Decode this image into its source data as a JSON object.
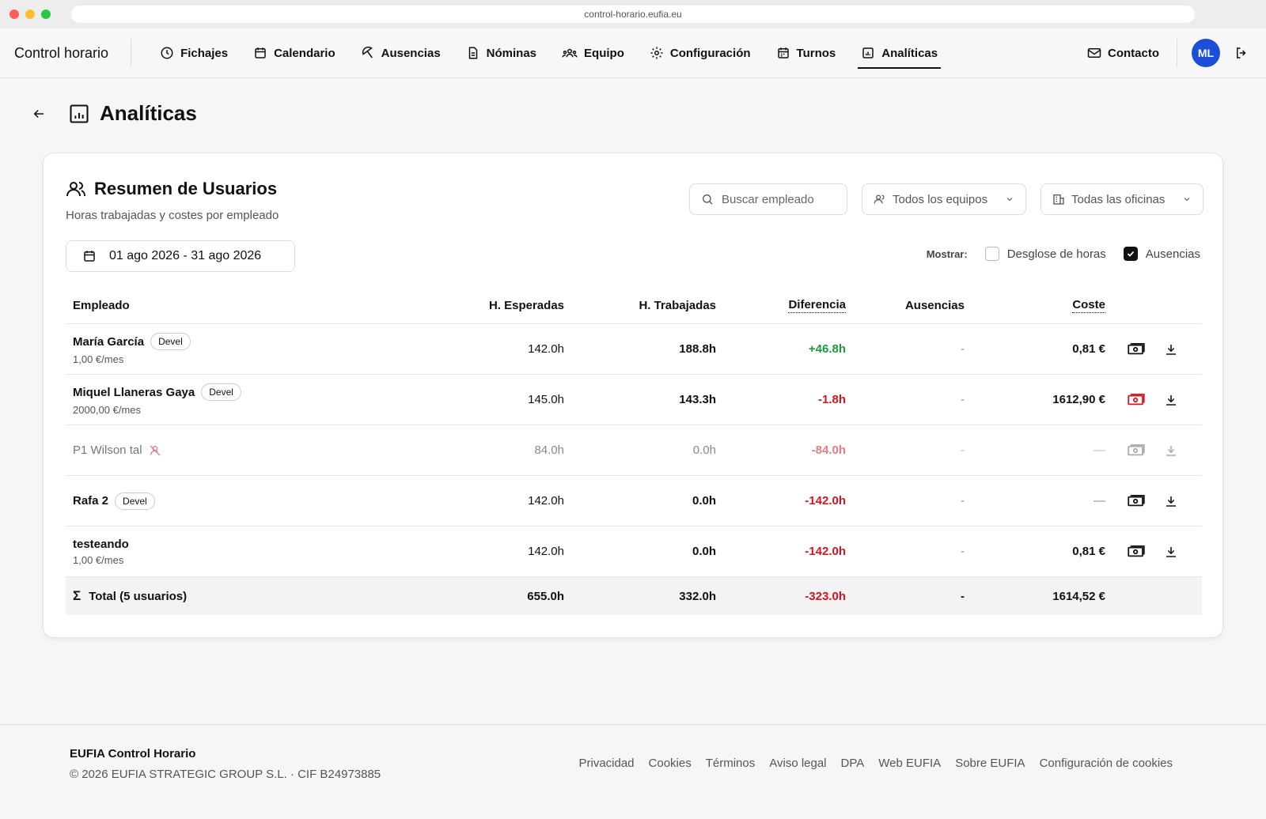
{
  "browser": {
    "url": "control-horario.eufia.eu"
  },
  "nav": {
    "brand": "Control horario",
    "items": [
      {
        "label": "Fichajes",
        "icon": "clock-icon"
      },
      {
        "label": "Calendario",
        "icon": "calendar-icon"
      },
      {
        "label": "Ausencias",
        "icon": "umbrella-icon"
      },
      {
        "label": "Nóminas",
        "icon": "document-icon"
      },
      {
        "label": "Equipo",
        "icon": "team-icon"
      },
      {
        "label": "Configuración",
        "icon": "gear-icon"
      },
      {
        "label": "Turnos",
        "icon": "calendar-icon"
      },
      {
        "label": "Analíticas",
        "icon": "chart-icon",
        "active": true
      }
    ],
    "contact": "Contacto",
    "avatar": "ML"
  },
  "page": {
    "title": "Analíticas"
  },
  "card": {
    "title": "Resumen de Usuarios",
    "subtitle": "Horas trabajadas y costes por empleado",
    "search_placeholder": "Buscar empleado",
    "teams_select": "Todos los equipos",
    "offices_select": "Todas las oficinas",
    "date_range": "01 ago 2026 - 31 ago 2026",
    "show_label": "Mostrar:",
    "opt_breakdown": "Desglose de horas",
    "opt_breakdown_checked": false,
    "opt_absences": "Ausencias",
    "opt_absences_checked": true
  },
  "table": {
    "headers": {
      "employee": "Empleado",
      "expected": "H. Esperadas",
      "worked": "H. Trabajadas",
      "difference": "Diferencia",
      "absences": "Ausencias",
      "cost": "Coste"
    },
    "rows": [
      {
        "name": "María García",
        "badge": "Devel",
        "rate": "1,00 €/mes",
        "expected": "142.0h",
        "worked": "188.8h",
        "difference": "+46.8h",
        "absences": "-",
        "cost": "0,81 €"
      },
      {
        "name": "Miquel Llaneras Gaya",
        "badge": "Devel",
        "rate": "2000,00 €/mes",
        "expected": "145.0h",
        "worked": "143.3h",
        "difference": "-1.8h",
        "absences": "-",
        "cost": "1612,90 €"
      },
      {
        "name": "P1 Wilson tal",
        "expected": "84.0h",
        "worked": "0.0h",
        "difference": "-84.0h",
        "absences": "-",
        "cost": "—"
      },
      {
        "name": "Rafa 2",
        "badge": "Devel",
        "expected": "142.0h",
        "worked": "0.0h",
        "difference": "-142.0h",
        "absences": "-",
        "cost": "—"
      },
      {
        "name": "testeando",
        "rate": "1,00 €/mes",
        "expected": "142.0h",
        "worked": "0.0h",
        "difference": "-142.0h",
        "absences": "-",
        "cost": "0,81 €"
      }
    ],
    "total": {
      "label": "Total (5 usuarios)",
      "expected": "655.0h",
      "worked": "332.0h",
      "difference": "-323.0h",
      "absences": "-",
      "cost": "1614,52 €"
    }
  },
  "footer": {
    "brand": "EUFIA Control Horario",
    "copyright": "© 2026 EUFIA STRATEGIC GROUP S.L. · CIF B24973885",
    "links": [
      "Privacidad",
      "Cookies",
      "Términos",
      "Aviso legal",
      "DPA",
      "Web EUFIA",
      "Sobre EUFIA",
      "Configuración de cookies"
    ]
  },
  "colors": {
    "accent": "#1d4fd6",
    "positive": "#1a9a3c",
    "negative": "#d9121f"
  }
}
